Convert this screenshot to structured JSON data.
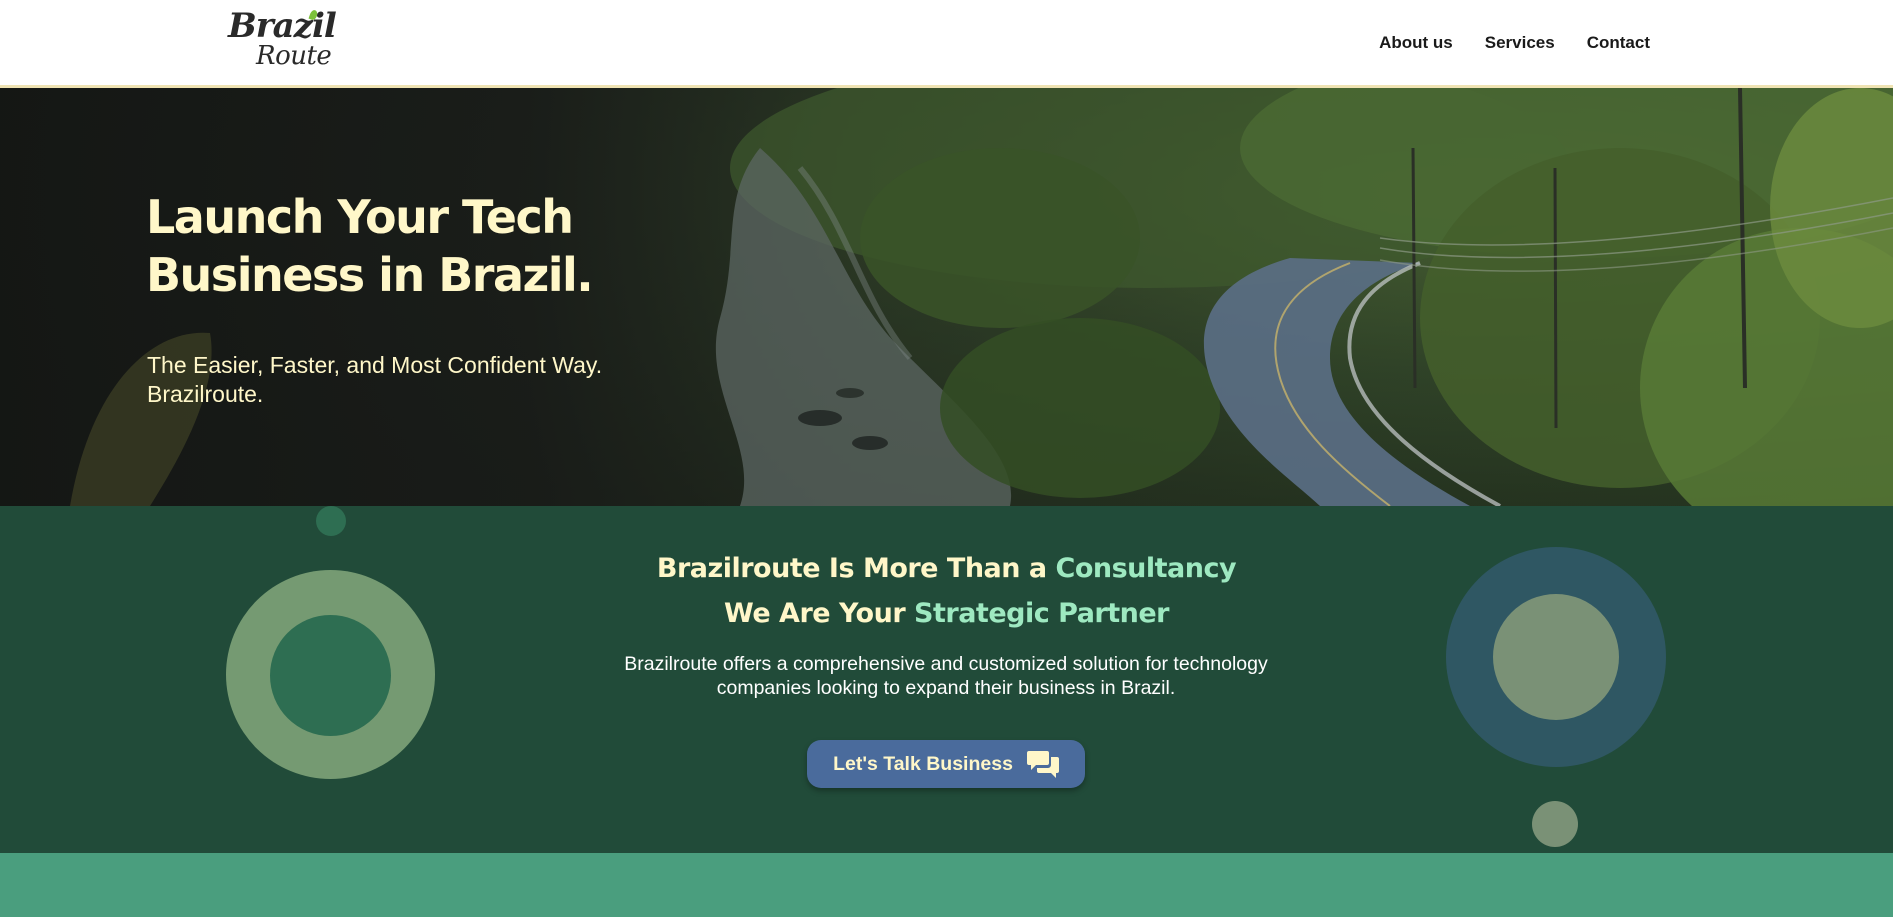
{
  "header": {
    "logo_line1": "Brazil",
    "logo_line2": "Route",
    "nav": [
      {
        "label": "About us"
      },
      {
        "label": "Services"
      },
      {
        "label": "Contact"
      }
    ]
  },
  "hero": {
    "title_line1": "Launch Your Tech",
    "title_line2": "Business in Brazil.",
    "subtitle": "The Easier, Faster, and Most Confident Way. Brazilroute."
  },
  "partner": {
    "heading1_prefix": "Brazilroute Is More Than a ",
    "heading1_accent": "Consultancy",
    "heading2_prefix": "We Are Your ",
    "heading2_accent": "Strategic Partner",
    "description": "Brazilroute offers a comprehensive and customized solution for technology companies looking to expand their business in Brazil.",
    "cta_label": "Let's Talk Business",
    "cta_icon": "chat-bubbles-icon"
  },
  "colors": {
    "header_bg": "#ffffff",
    "header_border": "#efe3b3",
    "hero_text": "#fff7c9",
    "section_bg": "#214b39",
    "accent_text": "#9ee9c1",
    "cta_bg": "#4a6b9c",
    "bottom_band": "#4a9e7e"
  }
}
